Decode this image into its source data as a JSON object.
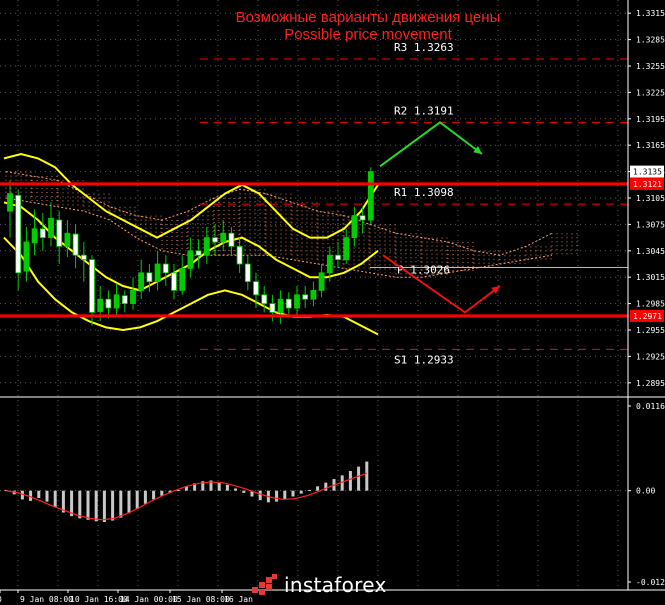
{
  "title": {
    "ru": "Возможные варианты движения цены",
    "en": "Possible price movement"
  },
  "price_axis": {
    "ticks": [
      "1.3315",
      "1.3285",
      "1.3255",
      "1.3225",
      "1.3195",
      "1.3165",
      "1.3135",
      "1.3105",
      "1.3075",
      "1.3045",
      "1.3015",
      "1.2985",
      "1.2955",
      "1.2925",
      "1.2895"
    ],
    "current_price": "1.3135",
    "resistance_tag": "1.3121",
    "support_tag": "1.2971"
  },
  "time_axis": {
    "labels": [
      "0",
      "9 Jan 08:00",
      "10 Jan 16:00",
      "14 Jan 00:00",
      "15 Jan 08:00",
      "16 Jan"
    ]
  },
  "oscillator_axis": {
    "ticks": [
      "0.01163",
      "0.00",
      "-0.01254"
    ]
  },
  "brand": {
    "name": "instaforex"
  },
  "colors": {
    "background": "#000000",
    "title": "#ff2020",
    "level_line": "#ff0000",
    "bands": "#ffff00",
    "candles": "#00cc00",
    "cloud": "#ff9966",
    "baseline": "#d4d400",
    "arrow_up": "#22dd22",
    "arrow_down": "#ee1111",
    "grid": "#ffffff",
    "signal": "#ff2020",
    "histogram": "#c8c8c8"
  },
  "chart_data": [
    {
      "type": "line",
      "panel": "price",
      "y_range": [
        1.288,
        1.333
      ],
      "levels": [
        {
          "label": "R3 1.3263",
          "value": 1.3263,
          "style": "dashed"
        },
        {
          "label": "R2 1.3191",
          "value": 1.3191,
          "style": "dashed"
        },
        {
          "label": "R1 1.3098",
          "value": 1.3098,
          "style": "dashed"
        },
        {
          "label": "P 1.3026",
          "value": 1.3026,
          "style": "solid"
        },
        {
          "label": "S1 1.2933",
          "value": 1.2933,
          "style": "dashed"
        }
      ],
      "key_levels": [
        1.3121,
        1.2971
      ],
      "scenarios": {
        "up": [
          1.3141,
          1.3191,
          1.3155
        ],
        "down": [
          1.304,
          1.2975,
          1.3005
        ]
      },
      "candles": [
        {
          "o": 1.309,
          "c": 1.311,
          "h": 1.3125,
          "l": 1.306
        },
        {
          "o": 1.3108,
          "c": 1.302,
          "h": 1.3115,
          "l": 1.3
        },
        {
          "o": 1.3022,
          "c": 1.3055,
          "h": 1.3072,
          "l": 1.301
        },
        {
          "o": 1.3054,
          "c": 1.307,
          "h": 1.3092,
          "l": 1.304
        },
        {
          "o": 1.307,
          "c": 1.306,
          "h": 1.3088,
          "l": 1.3045
        },
        {
          "o": 1.306,
          "c": 1.3082,
          "h": 1.31,
          "l": 1.305
        },
        {
          "o": 1.308,
          "c": 1.305,
          "h": 1.309,
          "l": 1.303
        },
        {
          "o": 1.305,
          "c": 1.3065,
          "h": 1.308,
          "l": 1.3038
        },
        {
          "o": 1.3064,
          "c": 1.304,
          "h": 1.3075,
          "l": 1.3025
        },
        {
          "o": 1.304,
          "c": 1.3035,
          "h": 1.3055,
          "l": 1.301
        },
        {
          "o": 1.3035,
          "c": 1.2975,
          "h": 1.304,
          "l": 1.296
        },
        {
          "o": 1.2976,
          "c": 1.299,
          "h": 1.3005,
          "l": 1.2965
        },
        {
          "o": 1.299,
          "c": 1.298,
          "h": 1.3,
          "l": 1.2968
        },
        {
          "o": 1.298,
          "c": 1.2995,
          "h": 1.3008,
          "l": 1.297
        },
        {
          "o": 1.2994,
          "c": 1.2985,
          "h": 1.3,
          "l": 1.2975
        },
        {
          "o": 1.2985,
          "c": 1.3,
          "h": 1.3015,
          "l": 1.2978
        },
        {
          "o": 1.3,
          "c": 1.302,
          "h": 1.3035,
          "l": 1.299
        },
        {
          "o": 1.302,
          "c": 1.301,
          "h": 1.303,
          "l": 1.2998
        },
        {
          "o": 1.301,
          "c": 1.303,
          "h": 1.3045,
          "l": 1.3
        },
        {
          "o": 1.303,
          "c": 1.302,
          "h": 1.304,
          "l": 1.3005
        },
        {
          "o": 1.302,
          "c": 1.3,
          "h": 1.303,
          "l": 1.299
        },
        {
          "o": 1.3,
          "c": 1.3025,
          "h": 1.304,
          "l": 1.2995
        },
        {
          "o": 1.3025,
          "c": 1.3045,
          "h": 1.306,
          "l": 1.3015
        },
        {
          "o": 1.3045,
          "c": 1.304,
          "h": 1.3058,
          "l": 1.3025
        },
        {
          "o": 1.304,
          "c": 1.306,
          "h": 1.3072,
          "l": 1.303
        },
        {
          "o": 1.306,
          "c": 1.3055,
          "h": 1.3075,
          "l": 1.304
        },
        {
          "o": 1.3055,
          "c": 1.3065,
          "h": 1.308,
          "l": 1.3045
        },
        {
          "o": 1.3065,
          "c": 1.305,
          "h": 1.3072,
          "l": 1.304
        },
        {
          "o": 1.305,
          "c": 1.303,
          "h": 1.306,
          "l": 1.302
        },
        {
          "o": 1.303,
          "c": 1.301,
          "h": 1.304,
          "l": 1.3
        },
        {
          "o": 1.301,
          "c": 1.2995,
          "h": 1.302,
          "l": 1.298
        },
        {
          "o": 1.2995,
          "c": 1.2985,
          "h": 1.3005,
          "l": 1.2975
        },
        {
          "o": 1.2985,
          "c": 1.2975,
          "h": 1.2995,
          "l": 1.2965
        },
        {
          "o": 1.2975,
          "c": 1.299,
          "h": 1.3,
          "l": 1.2962
        },
        {
          "o": 1.299,
          "c": 1.298,
          "h": 1.2998,
          "l": 1.297
        },
        {
          "o": 1.298,
          "c": 1.2995,
          "h": 1.3005,
          "l": 1.2972
        },
        {
          "o": 1.2995,
          "c": 1.299,
          "h": 1.3005,
          "l": 1.298
        },
        {
          "o": 1.299,
          "c": 1.3,
          "h": 1.301,
          "l": 1.2982
        },
        {
          "o": 1.3,
          "c": 1.302,
          "h": 1.303,
          "l": 1.2992
        },
        {
          "o": 1.302,
          "c": 1.304,
          "h": 1.305,
          "l": 1.301
        },
        {
          "o": 1.304,
          "c": 1.3035,
          "h": 1.3055,
          "l": 1.3025
        },
        {
          "o": 1.3035,
          "c": 1.306,
          "h": 1.307,
          "l": 1.303
        },
        {
          "o": 1.306,
          "c": 1.3085,
          "h": 1.3095,
          "l": 1.305
        },
        {
          "o": 1.3085,
          "c": 1.308,
          "h": 1.3095,
          "l": 1.3065
        },
        {
          "o": 1.308,
          "c": 1.3135,
          "h": 1.314,
          "l": 1.3075
        }
      ],
      "bands": {
        "upper": [
          1.315,
          1.3155,
          1.315,
          1.314,
          1.312,
          1.3105,
          1.309,
          1.308,
          1.307,
          1.306,
          1.307,
          1.308,
          1.3095,
          1.311,
          1.312,
          1.311,
          1.309,
          1.307,
          1.306,
          1.306,
          1.307,
          1.309,
          1.312
        ],
        "middle": [
          1.31,
          1.3095,
          1.308,
          1.306,
          1.3045,
          1.303,
          1.3015,
          1.3005,
          1.3,
          1.301,
          1.302,
          1.303,
          1.3045,
          1.3055,
          1.306,
          1.305,
          1.3035,
          1.3025,
          1.3015,
          1.3015,
          1.302,
          1.303,
          1.3045
        ],
        "lower": [
          1.306,
          1.304,
          1.301,
          1.299,
          1.2975,
          1.2965,
          1.2958,
          1.2955,
          1.2958,
          1.2965,
          1.2975,
          1.2985,
          1.2995,
          1.3,
          1.2995,
          1.2985,
          1.2975,
          1.297,
          1.297,
          1.2972,
          1.297,
          1.296,
          1.295
        ]
      },
      "cloud": {
        "span_a": [
          1.3135,
          1.313,
          1.3125,
          1.311,
          1.3095,
          1.3085,
          1.308,
          1.309,
          1.3105,
          1.3115,
          1.311,
          1.31,
          1.309,
          1.3085,
          1.3075,
          1.3065,
          1.306,
          1.3055,
          1.3045,
          1.304,
          1.305,
          1.3065
        ],
        "span_b": [
          1.3105,
          1.31,
          1.3095,
          1.309,
          1.308,
          1.306,
          1.3045,
          1.304,
          1.304,
          1.304,
          1.304,
          1.3035,
          1.303,
          1.3025,
          1.302,
          1.3015,
          1.3015,
          1.302,
          1.3025,
          1.303,
          1.3035,
          1.304
        ]
      }
    },
    {
      "type": "bar",
      "panel": "oscillator",
      "y_range": [
        -0.01254,
        0.01163
      ],
      "values": [
        0.0001,
        -0.0005,
        -0.0012,
        -0.0014,
        -0.001,
        -0.0015,
        -0.0022,
        -0.003,
        -0.0035,
        -0.0038,
        -0.004,
        -0.0042,
        -0.0043,
        -0.0041,
        -0.0037,
        -0.0031,
        -0.0025,
        -0.0018,
        -0.0012,
        -0.0007,
        -0.0003,
        0.0001,
        0.0006,
        0.001,
        0.0013,
        0.0014,
        0.0012,
        0.0008,
        0.0003,
        -0.0003,
        -0.0008,
        -0.0013,
        -0.0016,
        -0.0015,
        -0.0012,
        -0.0008,
        -0.0004,
        0.0001,
        0.0006,
        0.0011,
        0.0016,
        0.0021,
        0.0027,
        0.0033,
        0.004
      ],
      "signal": [
        0.0,
        -0.0003,
        -0.0008,
        -0.0015,
        -0.0022,
        -0.0028,
        -0.0034,
        -0.0038,
        -0.004,
        -0.0038,
        -0.0032,
        -0.0024,
        -0.0015,
        -0.0007,
        0.0,
        0.0006,
        0.001,
        0.0012,
        0.0011,
        0.0007,
        0.0002,
        -0.0004,
        -0.0009,
        -0.0012,
        -0.0011,
        -0.0007,
        -0.0001,
        0.0006,
        0.0012,
        0.0018,
        0.0024
      ]
    }
  ]
}
